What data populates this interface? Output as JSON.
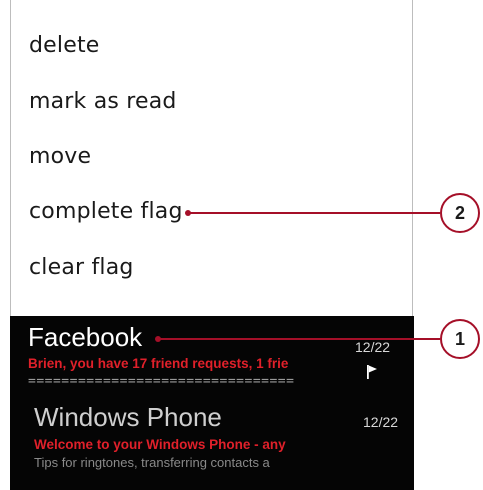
{
  "context_menu": {
    "items": [
      {
        "label": "delete"
      },
      {
        "label": "mark as read"
      },
      {
        "label": "move"
      },
      {
        "label": "complete flag"
      },
      {
        "label": "clear flag"
      }
    ]
  },
  "inbox": {
    "messages": [
      {
        "sender": "Facebook",
        "date": "12/22",
        "subject": "Brien, you have 17 friend requests, 1 frie",
        "preview": "================================",
        "flagged": true
      },
      {
        "sender": "Windows Phone",
        "date": "12/22",
        "subject": "Welcome to your Windows Phone - any",
        "preview": "Tips for ringtones, transferring contacts a",
        "flagged": false
      }
    ]
  },
  "callouts": [
    {
      "number": "1"
    },
    {
      "number": "2"
    }
  ],
  "colors": {
    "accent_red": "#e0202a",
    "callout": "#a50f28",
    "inbox_bg": "#050505"
  },
  "icons": {
    "flag": "flag-icon"
  }
}
